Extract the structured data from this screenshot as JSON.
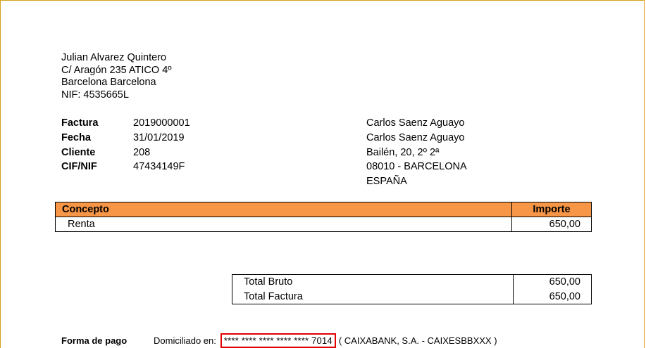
{
  "issuer": {
    "name": "Julian Alvarez Quintero",
    "address": "C/ Aragón 235 ATICO 4º",
    "city": "Barcelona Barcelona",
    "nif": "NIF: 4535665L"
  },
  "invoice_meta": [
    {
      "label": "Factura",
      "value": "2019000001"
    },
    {
      "label": "Fecha",
      "value": "31/01/2019"
    },
    {
      "label": "Cliente",
      "value": "208"
    },
    {
      "label": "CIF/NIF",
      "value": "47434149F"
    }
  ],
  "recipient": {
    "line1": "Carlos Saenz Aguayo",
    "line2": "Carlos Saenz Aguayo",
    "address": "Bailén, 20, 2º 2ª",
    "city": "08010 - BARCELONA",
    "country": "ESPAÑA"
  },
  "items_table": {
    "headers": {
      "concept": "Concepto",
      "amount": "Importe"
    },
    "rows": [
      {
        "concept": "Renta",
        "amount": "650,00"
      }
    ],
    "header_color": "#f79646"
  },
  "totals": [
    {
      "label": "Total Bruto",
      "value": "650,00"
    },
    {
      "label": "Total Factura",
      "value": "650,00"
    }
  ],
  "payment": {
    "label": "Forma de pago",
    "method": "Domiciliado en:",
    "account": "**** **** **** **** **** 7014",
    "bank": "( CAIXABANK, S.A. - CAIXESBBXXX  )",
    "highlight_color": "#e00000"
  }
}
